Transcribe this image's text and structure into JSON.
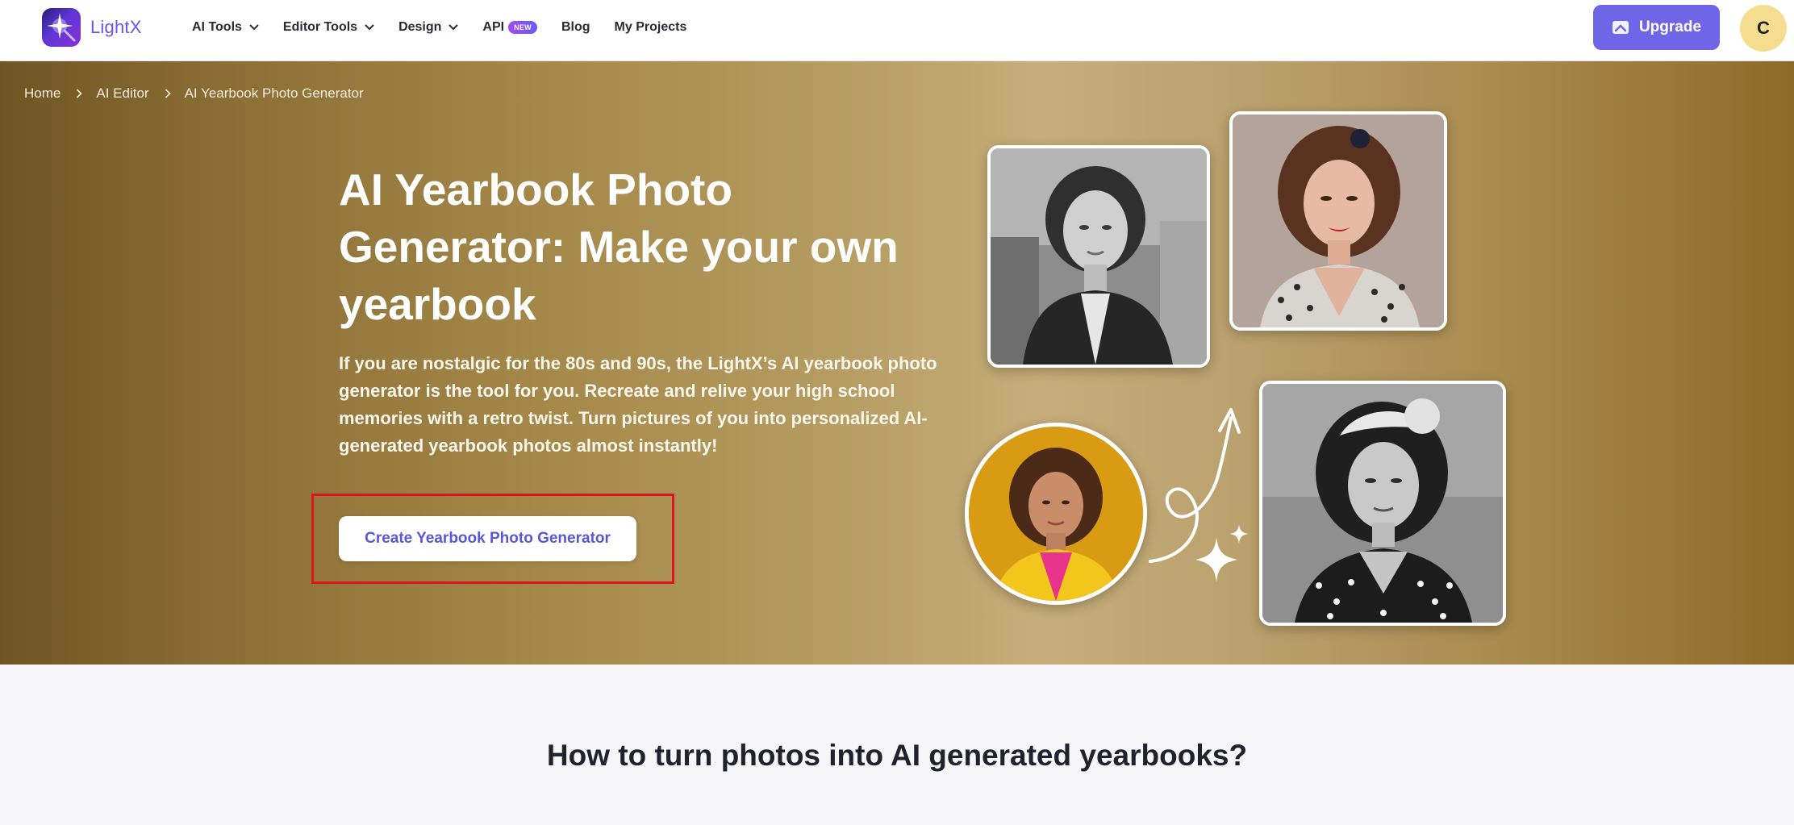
{
  "header": {
    "logo_text": "LightX",
    "nav": [
      {
        "label": "AI Tools",
        "has_dropdown": true
      },
      {
        "label": "Editor Tools",
        "has_dropdown": true
      },
      {
        "label": "Design",
        "has_dropdown": true
      },
      {
        "label": "API",
        "badge": "NEW"
      },
      {
        "label": "Blog"
      },
      {
        "label": "My Projects"
      }
    ],
    "upgrade_label": "Upgrade",
    "avatar_initial": "C"
  },
  "breadcrumb": {
    "items": [
      "Home",
      "AI Editor",
      "AI Yearbook Photo Generator"
    ]
  },
  "hero": {
    "title": "AI Yearbook Photo Generator: Make your own yearbook",
    "description": "If you are nostalgic for the 80s and 90s, the LightX’s AI yearbook photo generator is the tool for you. Recreate and relive your high school memories with a retro twist. Turn pictures of you into personalized AI-generated yearbook photos almost instantly!",
    "cta_label": "Create Yearbook Photo Generator"
  },
  "section": {
    "title": "How to turn photos into AI generated yearbooks?"
  },
  "icons": [
    "logo-icon",
    "chevron-down-icon",
    "upgrade-icon",
    "chevron-right-icon",
    "curved-arrow-icon",
    "sparkle-icon"
  ],
  "colors": {
    "brand": "#6a55e8",
    "upgrade_bg": "#6e66e6",
    "hero_gold": "#b39a5e",
    "highlight": "#e0121b",
    "avatar_bg": "#f5dd8f"
  }
}
